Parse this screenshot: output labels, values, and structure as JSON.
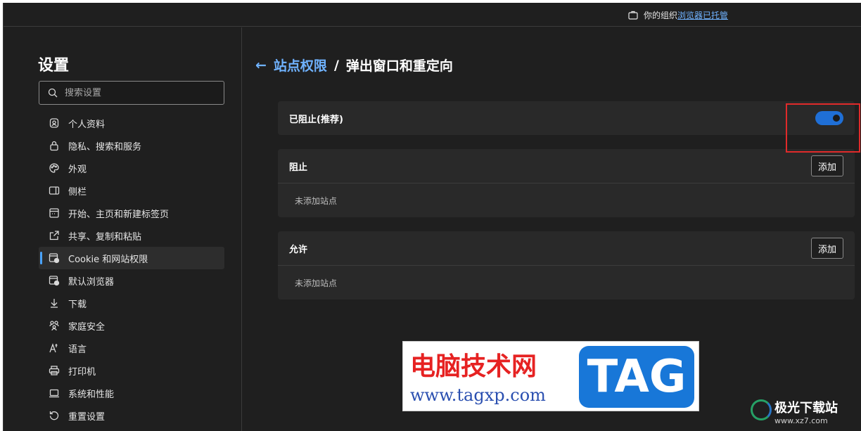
{
  "topbar": {
    "managed_prefix": "你的组织",
    "managed_link": "浏览器已托管"
  },
  "sidebar": {
    "title": "设置",
    "search_placeholder": "搜索设置",
    "items": [
      {
        "label": "个人资料",
        "icon": "profile-icon"
      },
      {
        "label": "隐私、搜索和服务",
        "icon": "lock-icon"
      },
      {
        "label": "外观",
        "icon": "palette-icon"
      },
      {
        "label": "侧栏",
        "icon": "sidebar-icon"
      },
      {
        "label": "开始、主页和新建标签页",
        "icon": "home-page-icon"
      },
      {
        "label": "共享、复制和粘贴",
        "icon": "share-icon"
      },
      {
        "label": "Cookie 和网站权限",
        "icon": "cookie-site-icon",
        "active": true
      },
      {
        "label": "默认浏览器",
        "icon": "default-browser-icon"
      },
      {
        "label": "下载",
        "icon": "download-icon"
      },
      {
        "label": "家庭安全",
        "icon": "family-icon"
      },
      {
        "label": "语言",
        "icon": "language-icon"
      },
      {
        "label": "打印机",
        "icon": "printer-icon"
      },
      {
        "label": "系统和性能",
        "icon": "laptop-icon"
      },
      {
        "label": "重置设置",
        "icon": "reset-icon"
      }
    ]
  },
  "main": {
    "breadcrumb": {
      "parent": "站点权限",
      "separator": "/",
      "current": "弹出窗口和重定向"
    },
    "blocked_toggle": {
      "label": "已阻止(推荐)",
      "on": true
    },
    "block": {
      "title": "阻止",
      "add_label": "添加",
      "empty": "未添加站点"
    },
    "allow": {
      "title": "允许",
      "add_label": "添加",
      "empty": "未添加站点"
    }
  },
  "watermark": {
    "cn": "电脑技术网",
    "url": "www.tagxp.com",
    "tag": "TAG",
    "logo_cn": "极光下载站",
    "logo_url": "www.xz7.com"
  },
  "colors": {
    "accent": "#6fb2ff",
    "toggle_on": "#1f6fd6",
    "highlight_box": "#e02a2a"
  }
}
